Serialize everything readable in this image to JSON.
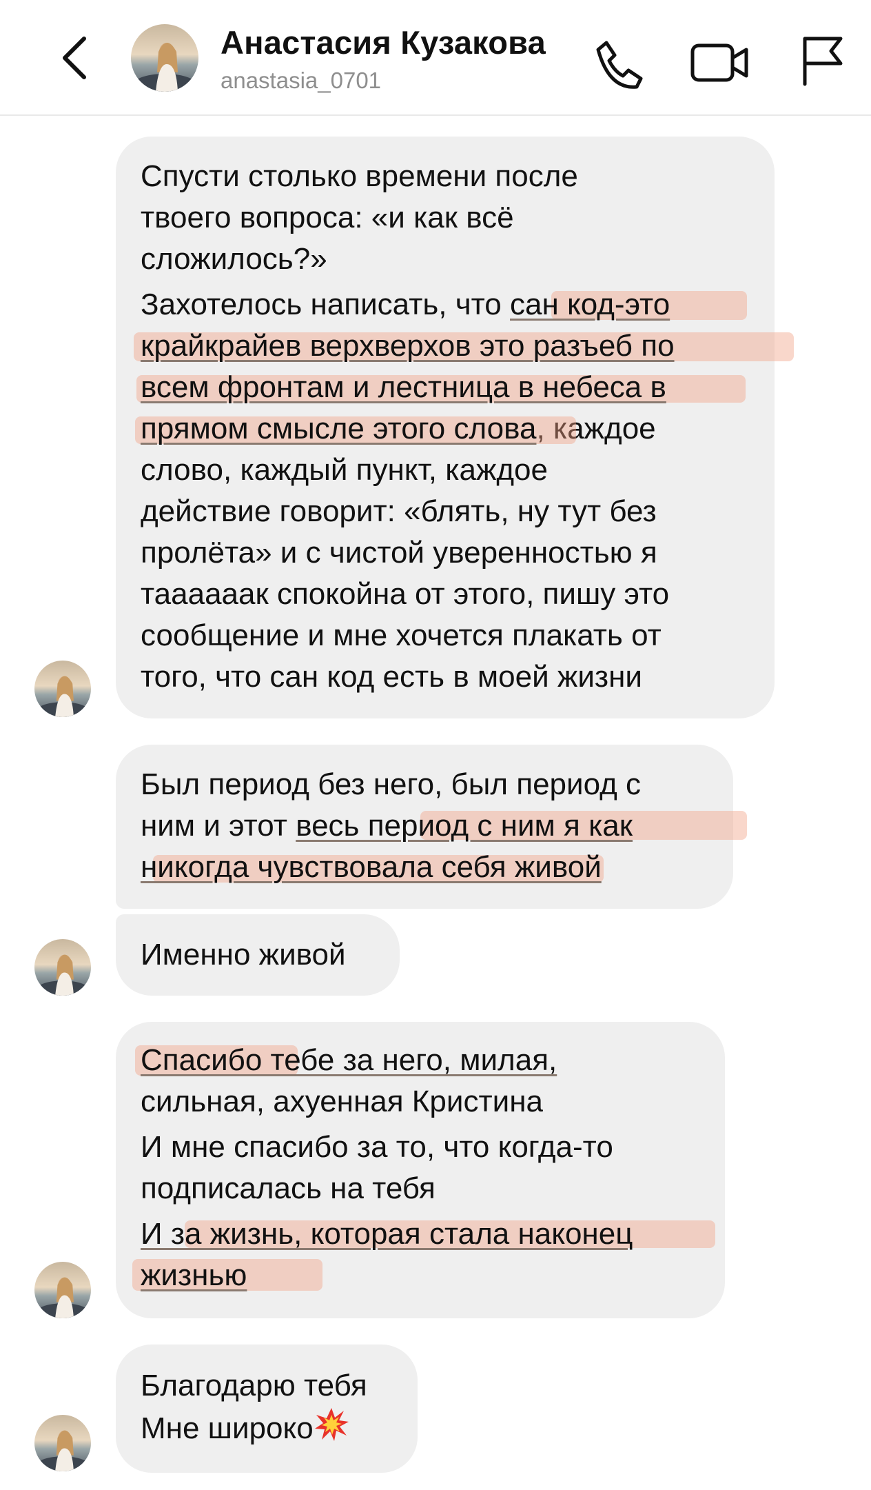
{
  "header": {
    "contact_name": "Анастасия Кузакова",
    "username": "anastasia_0701",
    "icons": [
      "chevron-left-icon",
      "phone-icon",
      "video-camera-icon",
      "flag-icon"
    ]
  },
  "messages": [
    {
      "lines": [
        "Спусти столько времени после",
        "твоего вопроса: «и как всё",
        "сложилось?»"
      ],
      "lines2": [
        {
          "pre": "Захотелось написать, что ",
          "hl": "сан код-это",
          "post": ""
        },
        {
          "pre": "",
          "hl": "крайкрайев верхверхов это разъеб по",
          "post": ""
        },
        {
          "pre": "",
          "hl": "всем фронтам и лестница в небеса в",
          "post": ""
        },
        {
          "pre": "",
          "hl": "прямом смысле этого слова",
          "post": ", каждое"
        },
        {
          "pre": "слово, каждый пункт, каждое",
          "hl": "",
          "post": ""
        },
        {
          "pre": "действие говорит: «блять, ну тут без",
          "hl": "",
          "post": ""
        },
        {
          "pre": "пролёта» и с чистой уверенностью я",
          "hl": "",
          "post": ""
        },
        {
          "pre": "таааааак спокойна от этого, пишу это",
          "hl": "",
          "post": ""
        },
        {
          "pre": "сообщение и мне хочется плакать от",
          "hl": "",
          "post": ""
        },
        {
          "pre": "того, что сан код есть в моей жизни",
          "hl": "",
          "post": ""
        }
      ]
    },
    {
      "lines": [
        {
          "pre": "Был период без него, был период с",
          "hl": "",
          "post": ""
        },
        {
          "pre": "ним и этот ",
          "hl": "весь период с ним я как",
          "post": ""
        },
        {
          "pre": "",
          "hl": "никогда чувствовала себя живой",
          "post": ""
        }
      ]
    },
    {
      "text": "Именно живой"
    },
    {
      "lines": [
        {
          "pre": "",
          "hl": "Спасибо тебе за него, милая,",
          "post": ""
        },
        {
          "pre": "сильная, ахуенная Кристина",
          "hl": "",
          "post": ""
        }
      ],
      "lines2": [
        "И мне спасибо за то, что когда-то",
        "подписалась на тебя"
      ],
      "lines3": [
        {
          "pre": "",
          "hl": "И за жизнь, которая стала наконец",
          "post": ""
        },
        {
          "pre": "",
          "hl": "жизнью",
          "post": ""
        }
      ]
    },
    {
      "line1": "Благодарю тебя",
      "line2": "Мне широко",
      "emoji": "collision-emoji"
    }
  ],
  "colors": {
    "bubble_bg": "#efefef",
    "highlight": "#f0a082",
    "username_gray": "#8e8e8e"
  }
}
